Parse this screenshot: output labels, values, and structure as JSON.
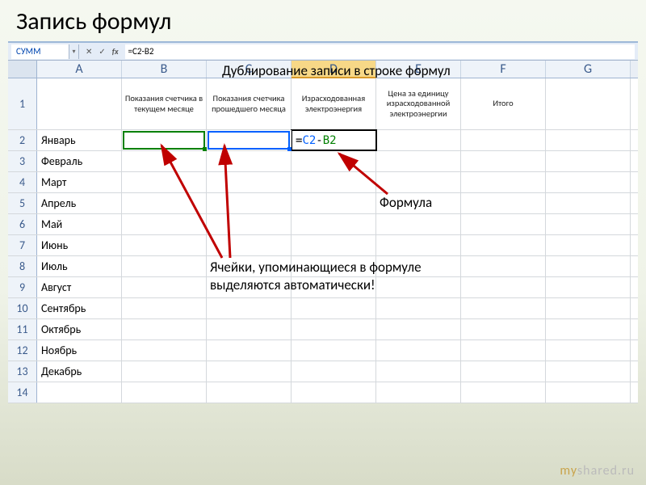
{
  "slide_title": "Запись формул",
  "annotations": {
    "formula_bar_note": "Дублирование записи в строке формул",
    "formula_note": "Формула",
    "cells_note_line1": "Ячейки, упоминающиеся в формуле",
    "cells_note_line2": "выделяются автоматически!"
  },
  "formula_bar": {
    "name_box": "СУММ",
    "cancel": "✕",
    "confirm": "✓",
    "fx": "fx",
    "formula_text": "=C2-B2"
  },
  "columns": [
    "A",
    "B",
    "C",
    "D",
    "E",
    "F",
    "G"
  ],
  "selected_column": "D",
  "headers_row": {
    "A": "",
    "B": "Показания счетчика в текущем месяце",
    "C": "Показания счетчика прошедшего месяца",
    "D": "Израсходованная электроэнергия",
    "E": "Цена за единицу израсходованной электроэнергии",
    "F": "Итого",
    "G": ""
  },
  "months": {
    "2": "Январь",
    "3": "Февраль",
    "4": "Март",
    "5": "Апрель",
    "6": "Май",
    "7": "Июнь",
    "8": "Июль",
    "9": "Август",
    "10": "Сентябрь",
    "11": "Октябрь",
    "12": "Ноябрь",
    "13": "Декабрь",
    "14": ""
  },
  "active_formula": {
    "eq": "=",
    "ref1": "C2",
    "op": "-",
    "ref2": "B2"
  },
  "watermark": {
    "prefix": "my",
    "suffix": "shared.ru"
  }
}
